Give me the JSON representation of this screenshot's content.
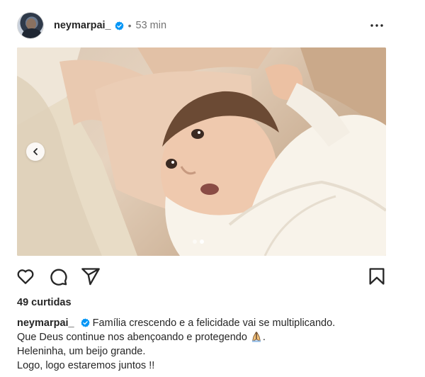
{
  "post": {
    "username": "neymarpai_",
    "time_separator": "•",
    "time_ago": "53 min",
    "verified": true,
    "likes_text": "49 curtidas",
    "carousel": {
      "total": 2,
      "active_index": 2
    },
    "caption": {
      "username": "neymarpai_",
      "line1": "Família crescendo e a felicidade vai se multiplicando.",
      "line2_before_emoji": "Que Deus continue nos abençoando e protegendo ",
      "line2_after_emoji": ".",
      "line3": "Heleninha, um beijo grande.",
      "line4": "Logo, logo estaremos juntos !!"
    },
    "icons": {
      "more": "more-options-icon",
      "like": "heart-icon",
      "comment": "comment-icon",
      "share": "share-icon",
      "save": "bookmark-icon",
      "prev": "chevron-left-icon",
      "verified": "verified-badge-icon",
      "emoji": "praying-hands-emoji"
    },
    "colors": {
      "verified": "#0095f6",
      "text": "#262626",
      "muted": "#737373"
    }
  }
}
